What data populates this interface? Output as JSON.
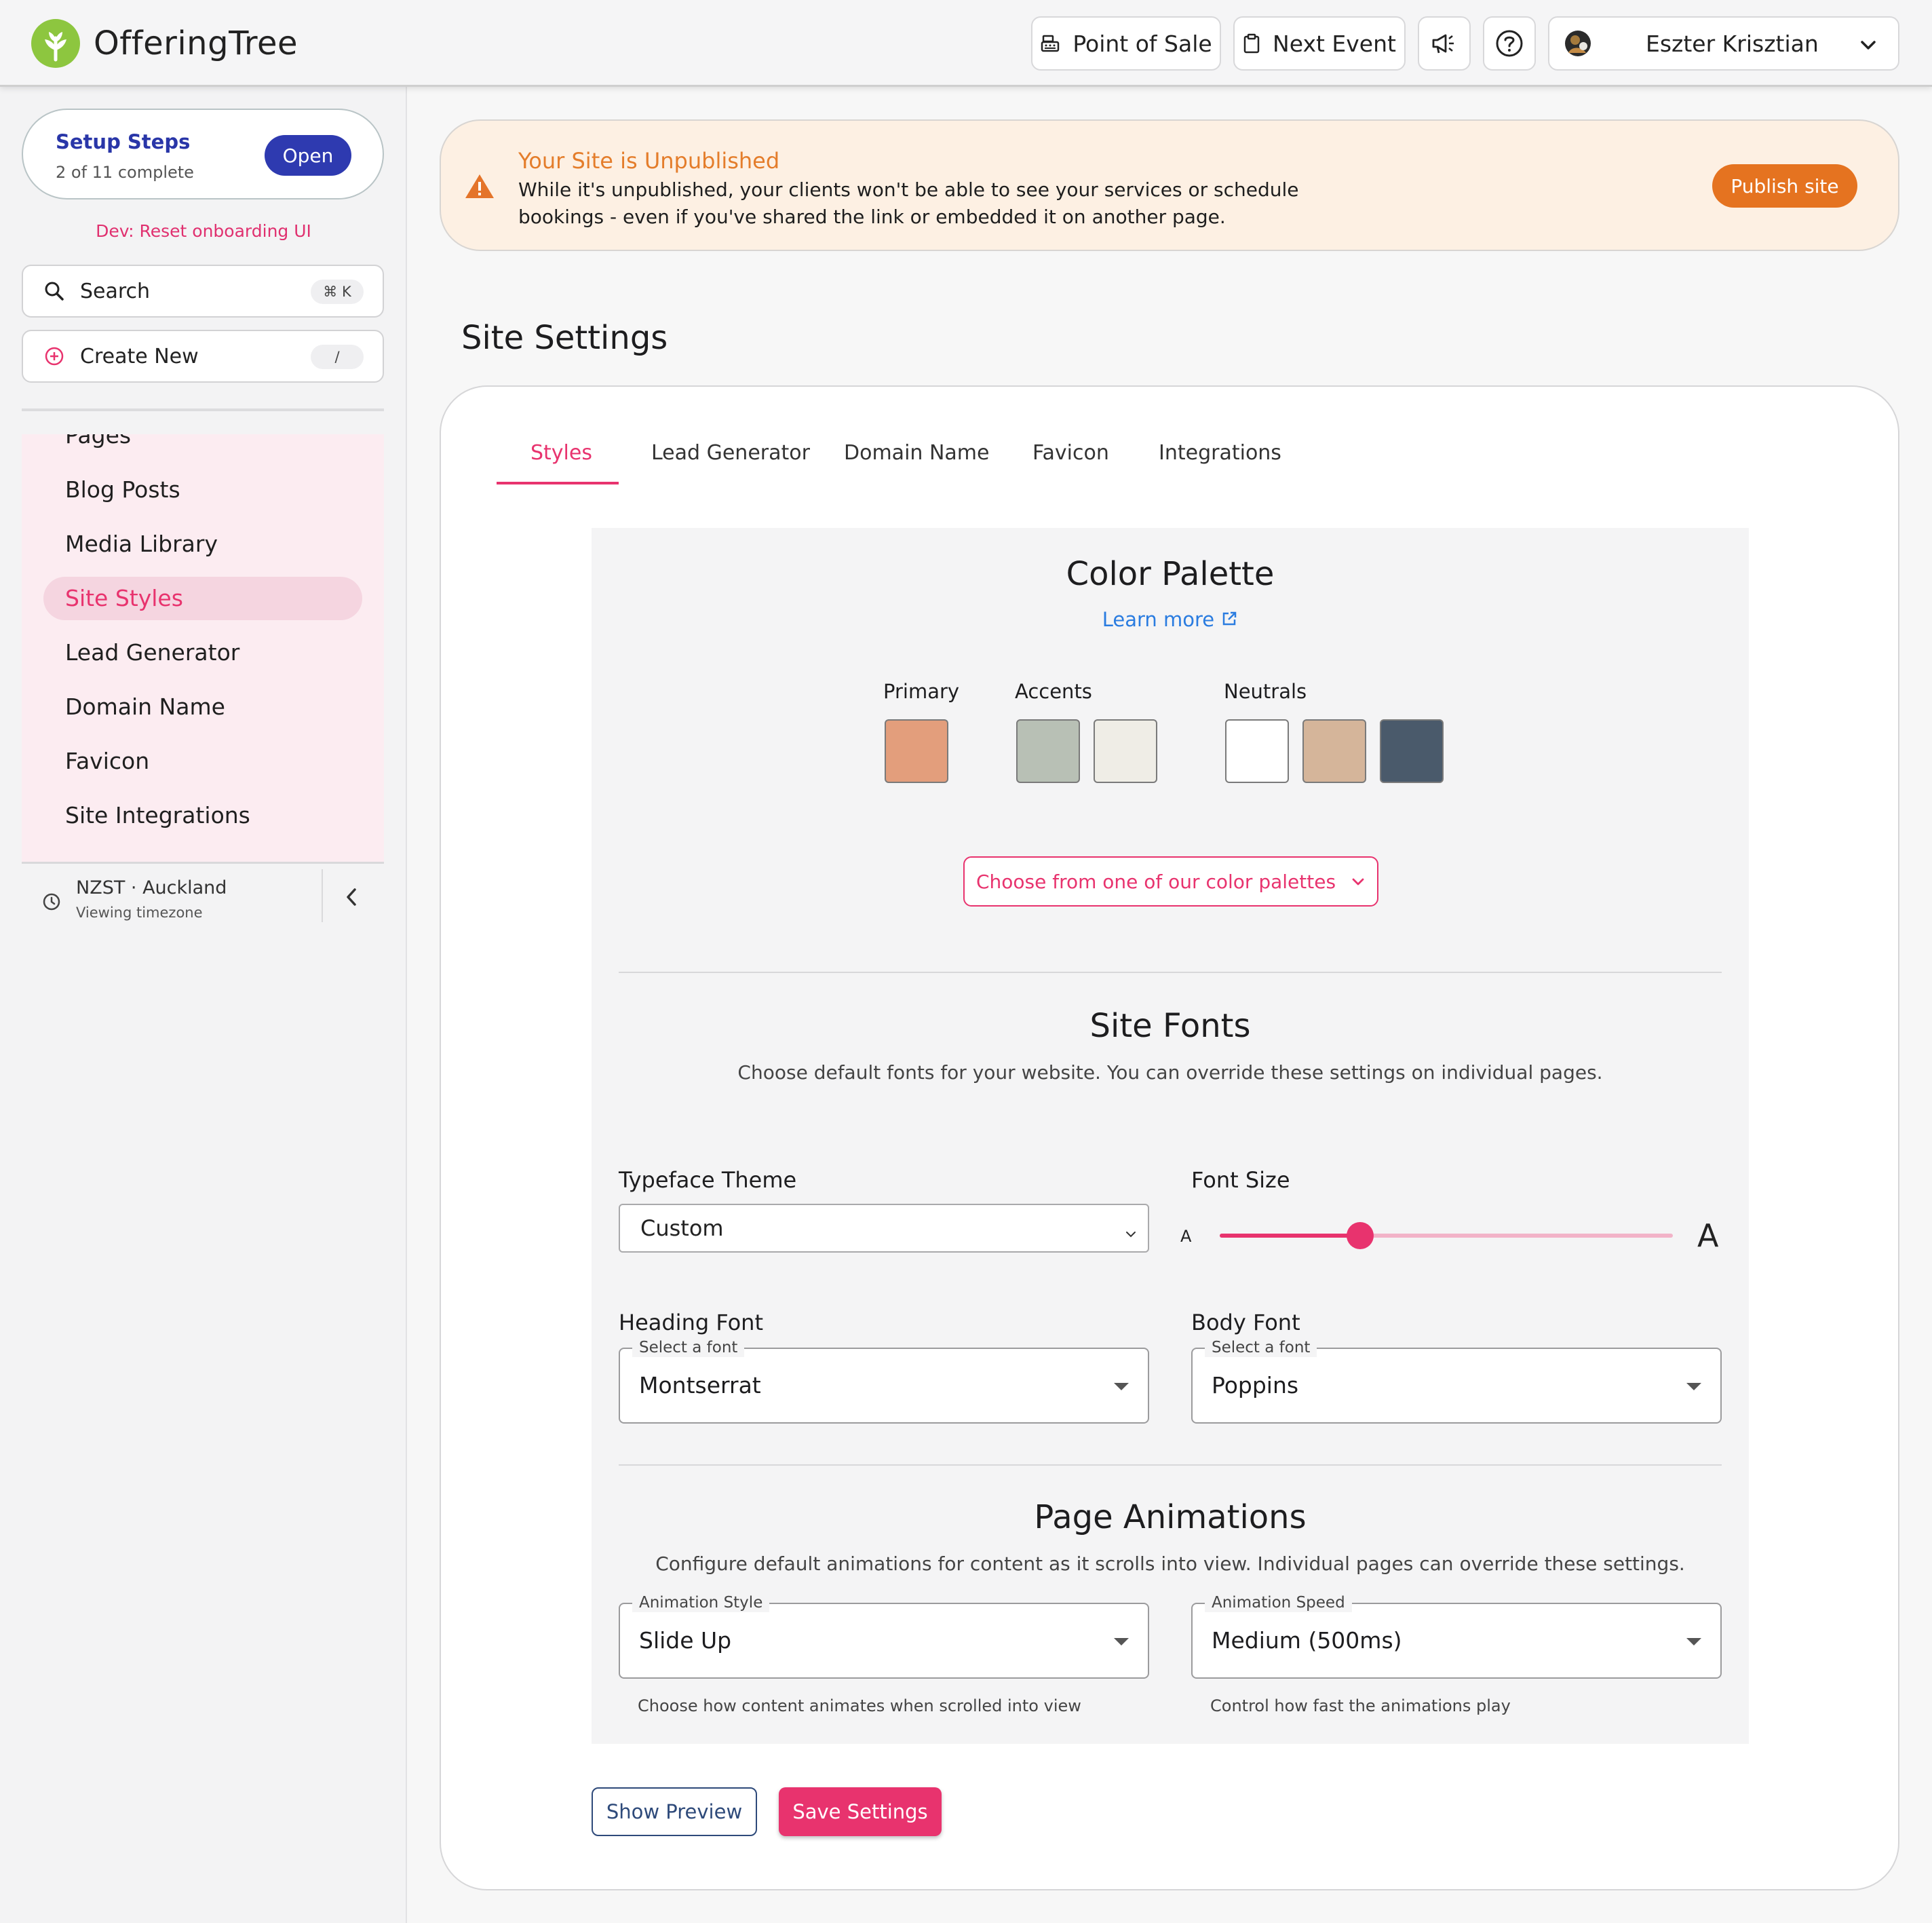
{
  "app": {
    "name": "OfferingTree"
  },
  "header": {
    "point_of_sale": "Point of Sale",
    "next_event": "Next Event",
    "user_name": "Eszter Krisztian"
  },
  "sidebar": {
    "setup": {
      "title": "Setup Steps",
      "progress": "2 of 11 complete",
      "open_label": "Open"
    },
    "dev_reset": "Dev: Reset onboarding UI",
    "search": {
      "label": "Search",
      "shortcut": "⌘ K"
    },
    "create_new": {
      "label": "Create New",
      "shortcut": "/"
    },
    "items": [
      {
        "label": "Pages"
      },
      {
        "label": "Blog Posts"
      },
      {
        "label": "Media Library"
      },
      {
        "label": "Site Styles",
        "active": true
      },
      {
        "label": "Lead Generator"
      },
      {
        "label": "Domain Name"
      },
      {
        "label": "Favicon"
      },
      {
        "label": "Site Integrations"
      }
    ],
    "timezone": {
      "name": "NZST · Auckland",
      "sub": "Viewing timezone"
    }
  },
  "banner": {
    "title": "Your Site is Unpublished",
    "text": "While it's unpublished, your clients won't be able to see your services or schedule bookings - even if you've shared the link or embedded it on another page.",
    "publish_label": "Publish site"
  },
  "page": {
    "title": "Site Settings"
  },
  "tabs": [
    {
      "label": "Styles",
      "active": true
    },
    {
      "label": "Lead Generator"
    },
    {
      "label": "Domain Name"
    },
    {
      "label": "Favicon"
    },
    {
      "label": "Integrations"
    }
  ],
  "color_palette": {
    "title": "Color Palette",
    "learn_more": "Learn more",
    "primary_label": "Primary",
    "accents_label": "Accents",
    "neutrals_label": "Neutrals",
    "primary": [
      "#e39e7c"
    ],
    "accents": [
      "#b8c0b5",
      "#efede6"
    ],
    "neutrals": [
      "#ffffff",
      "#d5b59a",
      "#4a5a6b"
    ],
    "choose_label": "Choose from one of our color palettes"
  },
  "site_fonts": {
    "title": "Site Fonts",
    "subtitle": "Choose default fonts for your website. You can override these settings on individual pages.",
    "typeface_label": "Typeface Theme",
    "typeface_value": "Custom",
    "font_size_label": "Font Size",
    "font_size_small": "A",
    "font_size_large": "A",
    "font_size_fraction": 0.31,
    "heading_label": "Heading Font",
    "heading_legend": "Select a font",
    "heading_value": "Montserrat",
    "body_label": "Body Font",
    "body_legend": "Select a font",
    "body_value": "Poppins"
  },
  "animations": {
    "title": "Page Animations",
    "subtitle": "Configure default animations for content as it scrolls into view. Individual pages can override these settings.",
    "style_legend": "Animation Style",
    "style_value": "Slide Up",
    "style_helper": "Choose how content animates when scrolled into view",
    "speed_legend": "Animation Speed",
    "speed_value": "Medium (500ms)",
    "speed_helper": "Control how fast the animations play"
  },
  "actions": {
    "preview_label": "Show Preview",
    "save_label": "Save Settings"
  },
  "colors": {
    "accent": "#e8336e",
    "brand_green": "#8dc63f",
    "warning": "#e57320",
    "setup_blue": "#2e3ab0"
  }
}
